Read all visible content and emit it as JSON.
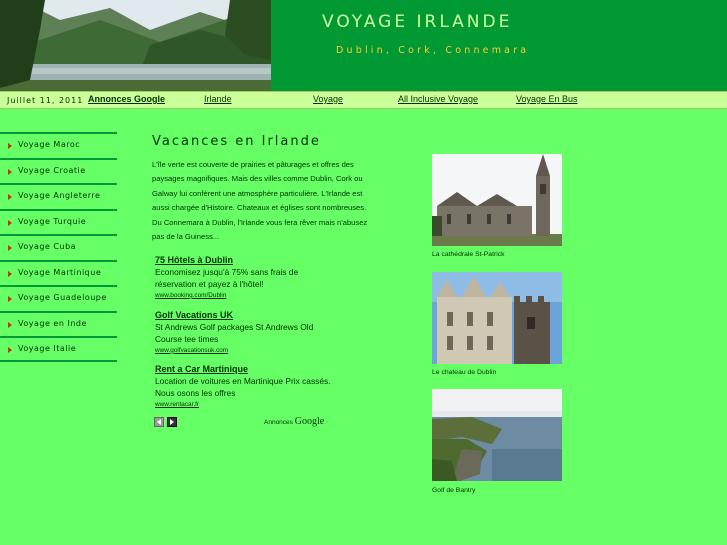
{
  "header": {
    "title": "VOYAGE IRLANDE",
    "tagline": "Dublin, Cork, Connemara"
  },
  "navbar": {
    "date": "Juillet 11, 2011",
    "links": [
      {
        "label": "Annonces Google"
      },
      {
        "label": "Irlande"
      },
      {
        "label": "Voyage"
      },
      {
        "label": "All Inclusive Voyage"
      },
      {
        "label": "Voyage En Bus"
      }
    ]
  },
  "sidebar": {
    "items": [
      {
        "label": "Voyage Maroc"
      },
      {
        "label": "Voyage Croatie"
      },
      {
        "label": "Voyage Angleterre"
      },
      {
        "label": "Voyage Turquie"
      },
      {
        "label": "Voyage Cuba"
      },
      {
        "label": "Voyage Martinique"
      },
      {
        "label": "Voyage Guadeloupe"
      },
      {
        "label": "Voyage en Inde"
      },
      {
        "label": "Voyage Italie"
      }
    ]
  },
  "main": {
    "title": "Vacances en Irlande",
    "intro": "L'île verte est couverte de prairies et pâturages et offres des paysages magnifiques. Mais des villes comme Dublin, Cork ou Galway lui confèrent une atmosphère particulière. L'Irlande est aussi chargée d'Histoire. Chateaux et églises sont nombreuses. Du Connemara à Dublin, l'Irlande vous fera rêver mais n'abusez pas de la Guiness...",
    "ads": [
      {
        "title": "75 Hôtels à Dublin",
        "desc": "Economisez jusqu'à 75% sans frais de réservation et payez à l'hôtel!",
        "url": "www.booking.com/Dublin"
      },
      {
        "title": "Golf Vacations UK",
        "desc": "St Andrews Golf packages St Andrews Old Course tee times",
        "url": "www.golfvacationsuk.com"
      },
      {
        "title": "Rent a Car Martinique",
        "desc": "Location de voitures en Martinique Prix cassés. Nous osons les offres",
        "url": "www.rentacar.fr"
      }
    ],
    "ads_by_prefix": "Annonces",
    "ads_by_brand": "Google"
  },
  "photos": [
    {
      "caption": "La cathédrale St-Patrick"
    },
    {
      "caption": "Le chateau de Dublin"
    },
    {
      "caption": "Golf de Bantry"
    }
  ],
  "colors": {
    "background": "#66ff66",
    "header": "#009933",
    "title": "#ccff99",
    "tagline": "#ffcc33",
    "navbar": "#ccff99"
  },
  "icons": [
    "bullet-arrow-icon",
    "prev-arrow-icon",
    "next-arrow-icon"
  ]
}
